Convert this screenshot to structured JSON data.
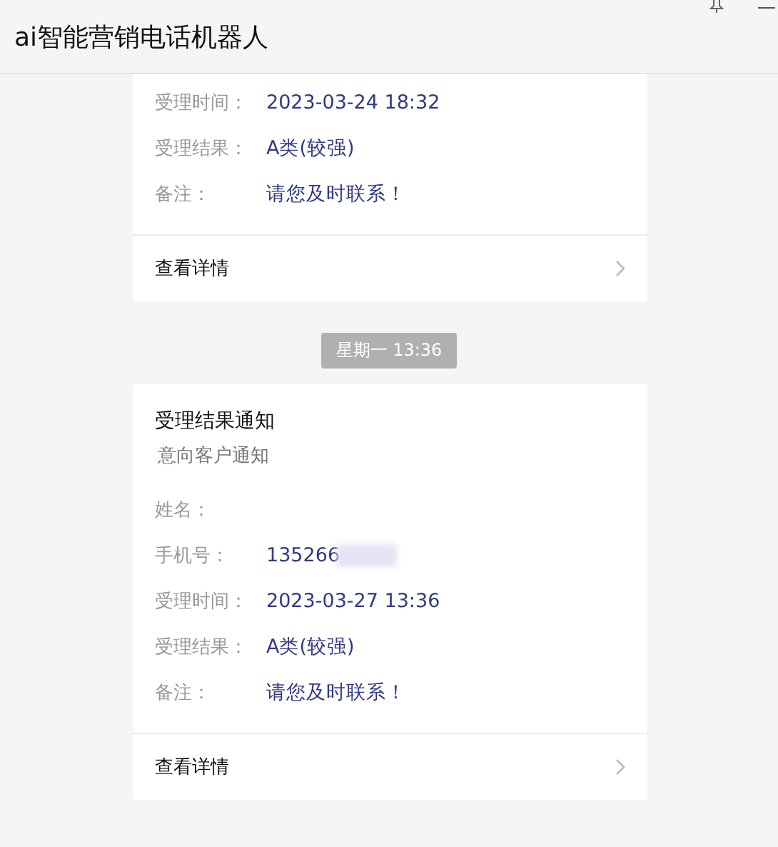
{
  "window": {
    "title": "ai智能营销电话机器人"
  },
  "messages": [
    {
      "kind": "card",
      "fields": [
        {
          "label": "受理时间：",
          "value": "2023-03-24 18:32"
        },
        {
          "label": "受理结果：",
          "value": "A类(较强)"
        },
        {
          "label": "备注：",
          "value": "请您及时联系！"
        }
      ],
      "link": "查看详情"
    },
    {
      "kind": "timestamp",
      "text": "星期一  13:36"
    },
    {
      "kind": "card",
      "title": "受理结果通知",
      "subtitle": "意向客户通知",
      "fields": [
        {
          "label": "姓名："
        },
        {
          "label": "手机号：",
          "value": "135266",
          "redacted": true
        },
        {
          "label": "受理时间：",
          "value": "2023-03-27 13:36"
        },
        {
          "label": "受理结果：",
          "value": "A类(较强)"
        },
        {
          "label": "备注：",
          "value": "请您及时联系！"
        }
      ],
      "link": "查看详情"
    }
  ]
}
